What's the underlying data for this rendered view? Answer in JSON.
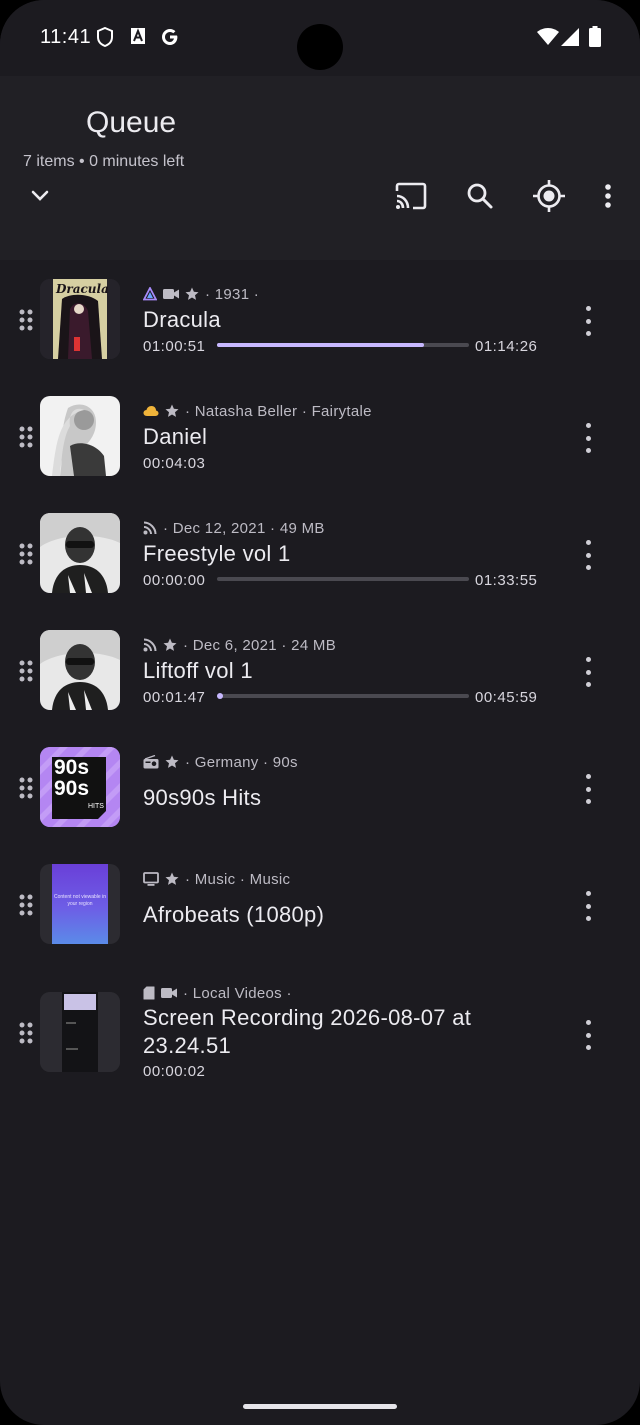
{
  "status": {
    "time": "11:41"
  },
  "header": {
    "title": "Queue",
    "subtitle": "7 items • 0 minutes left"
  },
  "items": [
    {
      "meta": "· 1931 ·",
      "title": "Dracula",
      "elapsed": "01:00:51",
      "total": "01:14:26",
      "progress": 0.82,
      "badges": [
        "triangle-icon",
        "video-icon",
        "star-icon"
      ]
    },
    {
      "meta": "· Natasha Beller · Fairytale",
      "title": "Daniel",
      "elapsed": "00:04:03",
      "badges": [
        "cloud-icon",
        "star-icon"
      ]
    },
    {
      "meta": "· Dec 12, 2021 · 49 MB",
      "title": "Freestyle vol 1",
      "elapsed": "00:00:00",
      "total": "01:33:55",
      "progress": 0.0,
      "badges": [
        "rss-icon"
      ]
    },
    {
      "meta": "· Dec 6, 2021 · 24 MB",
      "title": "Liftoff vol 1",
      "elapsed": "00:01:47",
      "total": "00:45:59",
      "progress": 0.04,
      "badges": [
        "rss-icon",
        "star-icon"
      ]
    },
    {
      "meta": "· Germany · 90s",
      "title": "90s90s Hits",
      "badges": [
        "radio-icon",
        "star-icon"
      ]
    },
    {
      "meta": "· Music · Music",
      "title": "Afrobeats (1080p)",
      "badges": [
        "tv-icon",
        "star-icon"
      ],
      "thumb_text": "Content not viewable in your region"
    },
    {
      "meta": "· Local Videos ·",
      "title": "Screen Recording 2026-08-07 at 23.24.51",
      "elapsed": "00:00:02",
      "badges": [
        "sd-card-icon",
        "video-icon"
      ]
    }
  ],
  "thumb_90s": {
    "line1": "90s",
    "line2": "90s",
    "tag": "HITS"
  },
  "colors": {
    "background": "#1c1b20",
    "appbar": "#212025",
    "accent": "#c7b8ff"
  }
}
